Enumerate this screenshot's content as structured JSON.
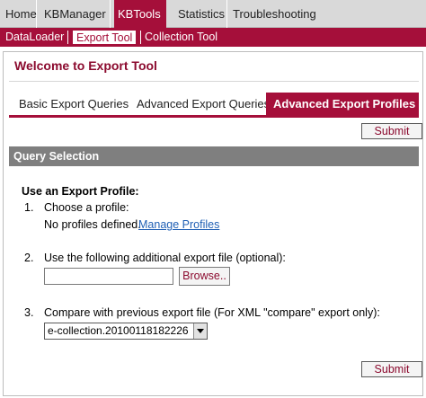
{
  "topnav": {
    "tabs": [
      {
        "label": "Home"
      },
      {
        "label": "KBManager"
      },
      {
        "label": "KBTools"
      },
      {
        "label": "Statistics"
      },
      {
        "label": "Troubleshooting"
      }
    ],
    "active": "KBTools"
  },
  "subnav": {
    "items": [
      {
        "label": "DataLoader"
      },
      {
        "label": "Export Tool"
      },
      {
        "label": "Collection Tool"
      }
    ],
    "active": "Export Tool"
  },
  "page": {
    "title": "Welcome to Export Tool"
  },
  "tabs": [
    {
      "label": "Basic Export Queries"
    },
    {
      "label": "Advanced Export Queries"
    },
    {
      "label": "Advanced Export Profiles"
    }
  ],
  "active_tab": "Advanced Export Profiles",
  "buttons": {
    "submit_top": "Submit",
    "submit_bottom": "Submit",
    "browse": "Browse.."
  },
  "section": {
    "title": "Query Selection"
  },
  "form": {
    "heading": "Use an Export Profile:",
    "step1": {
      "num": "1.",
      "label": "Choose a profile:",
      "status": "No profiles defined.",
      "link": "Manage Profiles"
    },
    "step2": {
      "num": "2.",
      "label": "Use the following additional export file (optional):",
      "value": ""
    },
    "step3": {
      "num": "3.",
      "label": "Compare with previous export file (For XML \"compare\" export only):",
      "selected": "e-collection.20100118182226"
    }
  },
  "colors": {
    "brand": "#a50f3a",
    "section_bar": "#7f7f7f",
    "link": "#1f5fb4"
  }
}
